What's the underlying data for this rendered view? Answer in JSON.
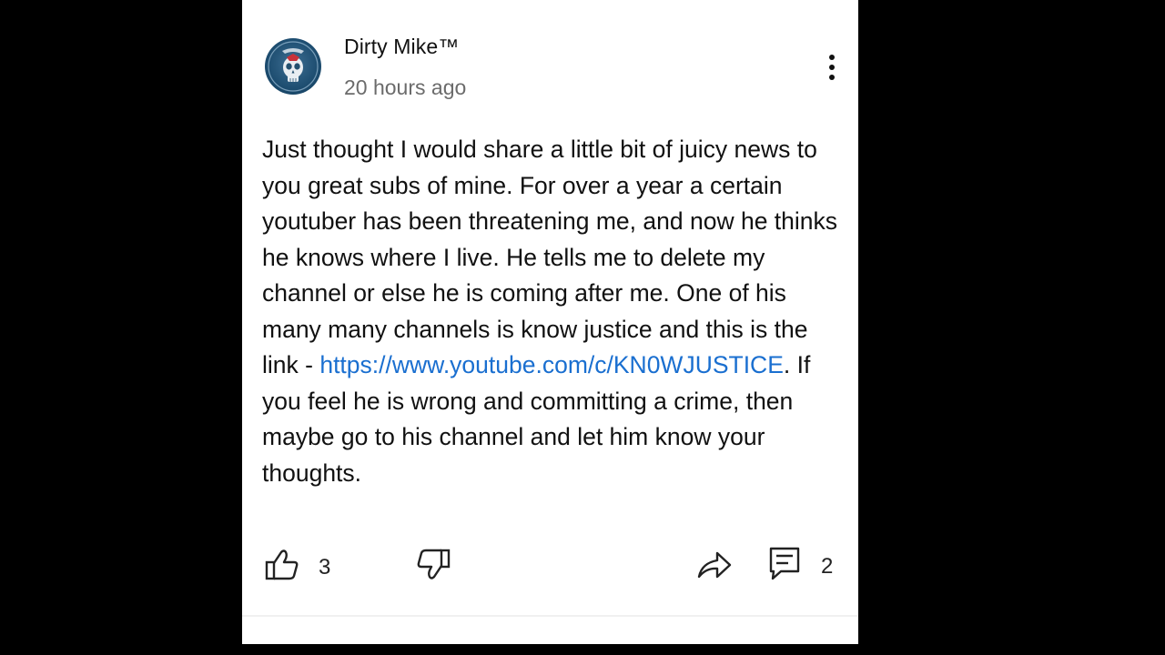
{
  "post": {
    "author": "Dirty Mike™",
    "timestamp": "20 hours ago",
    "body_intro": "Just thought I would share a little bit of juicy news to you great subs of mine. For over a year a certain youtuber has been threatening me, and now he thinks he knows where I live. He tells me to delete my channel or else he is coming after me. One of his many many channels is know justice and this is the link - ",
    "link_text": "https://www.youtube.com/c/KN0WJUSTICE",
    "body_outro": ". If you feel he is wrong and committing a crime, then maybe go to his channel and let him know your thoughts."
  },
  "actions": {
    "like_count": "3",
    "comment_count": "2"
  },
  "icons": {
    "menu": "more-vertical-icon",
    "like": "thumbs-up-icon",
    "dislike": "thumbs-down-icon",
    "share": "share-icon",
    "comments": "comment-icon"
  },
  "colors": {
    "page_background": "#000000",
    "card_background": "#ffffff",
    "link": "#1a6fd0",
    "secondary_text": "#6b6b6b",
    "avatar_background": "#1d4d70"
  }
}
